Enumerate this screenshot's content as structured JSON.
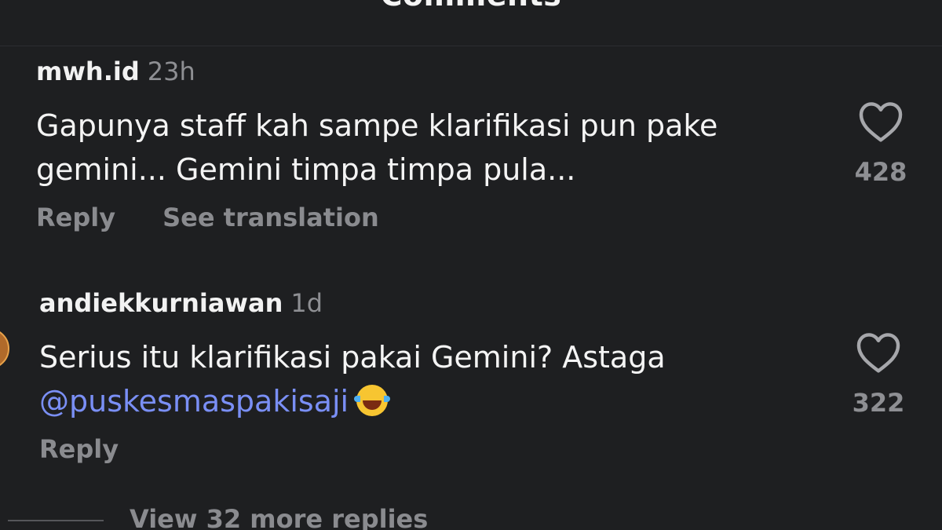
{
  "header": {
    "title": "Comments"
  },
  "comments": [
    {
      "username": "mwh.id",
      "time": "23h",
      "text_line1": "Gapunya staff kah sampe klarifikasi pun pake",
      "text_line2": "gemini... Gemini timpa timpa pula...",
      "like_count": "428",
      "reply_label": "Reply",
      "translate_label": "See translation"
    },
    {
      "username": "andiekkurniawan",
      "time": "1d",
      "text_line1": "Serius itu klarifikasi pakai Gemini? Astaga",
      "mention": "@puskesmaspakisaji",
      "emoji": "face-with-tears-of-joy",
      "like_count": "322",
      "reply_label": "Reply",
      "view_replies_label": "View 32 more replies"
    }
  ],
  "colors": {
    "background": "#1e1f21",
    "text": "#f4f4f4",
    "muted": "#8a8b8f",
    "mention": "#7a8ff5"
  }
}
